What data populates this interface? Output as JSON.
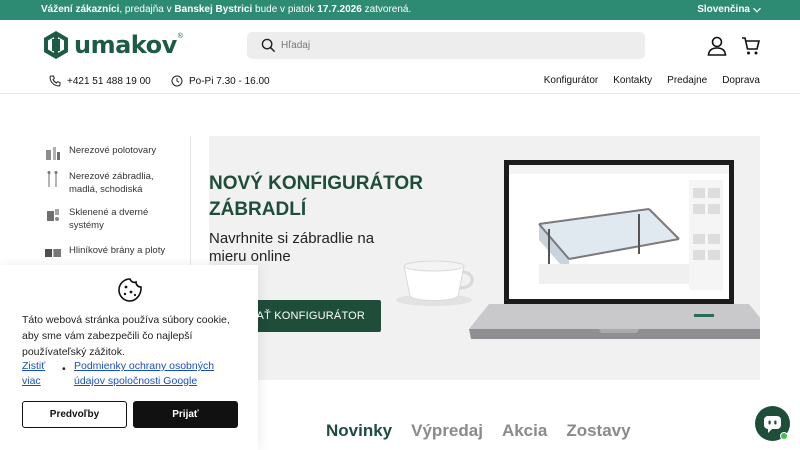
{
  "announcement": {
    "lead": "Vážení zákazníci",
    "mid1": ", predajňa v ",
    "city": "Banskej Bystrici",
    "mid2": " bude v piatok ",
    "date": "17.7.2026",
    "tail": " zatvorená.",
    "language": "Slovenčina"
  },
  "header": {
    "logo_text": "umakov",
    "logo_reg": "®",
    "search_placeholder": "Hľadaj"
  },
  "subnav": {
    "phone": "+421 51 488 19 00",
    "hours": "Po-Pi 7.30 - 16.00",
    "links": [
      "Konfigurátor",
      "Kontakty",
      "Predajne",
      "Doprava"
    ]
  },
  "sidebar": {
    "categories": [
      "Nerezové polotovary",
      "Nerezové zábradlia, madlá, schodiská",
      "Sklenené a dverné systémy",
      "Hliníkové brány a ploty"
    ]
  },
  "hero": {
    "title_line1": "NOVÝ KONFIGURÁTOR",
    "title_line2": "ZÁBRADLÍ",
    "sub_line1": "Navrhnite si zábradlie na",
    "sub_line2": "mieru online",
    "cta": "SAŤ KONFIGURÁTOR"
  },
  "tabs": [
    "Novinky",
    "Výpredaj",
    "Akcia",
    "Zostavy"
  ],
  "cookie": {
    "text": "Táto webová stránka používa súbory cookie, aby sme vám zabezpečili čo najlepší používateľský zážitok.",
    "link_more": "Zistiť viac",
    "link_policy": "Podmienky ochrany osobných údajov spoločnosti Google",
    "btn_preferences": "Predvoľby",
    "btn_accept": "Prijať"
  },
  "colors": {
    "brand": "#1e4d3a",
    "announcement_bg": "#2e8b73",
    "online_dot": "#3cc24f"
  },
  "icons": [
    "chevron-down-icon",
    "search-icon",
    "account-icon",
    "cart-icon",
    "phone-icon",
    "clock-icon",
    "cookie-icon",
    "chat-icon"
  ]
}
